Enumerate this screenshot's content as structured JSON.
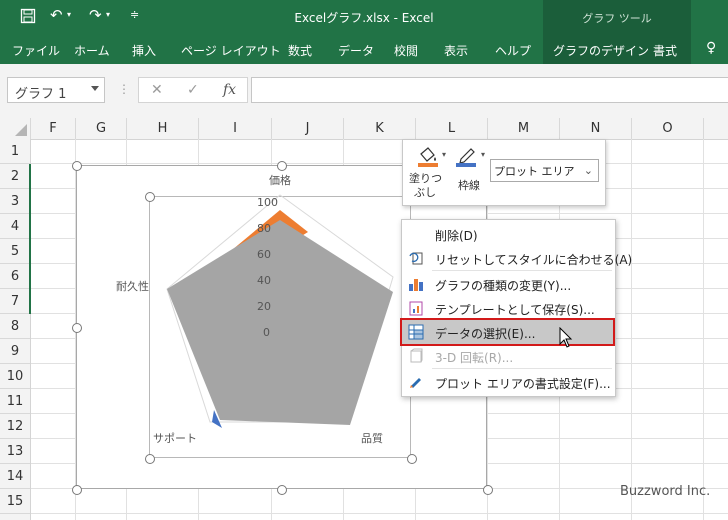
{
  "window": {
    "title": "Excelグラフ.xlsx  -  Excel",
    "chart_tools": "グラフ ツール"
  },
  "ribbon": {
    "tabs": [
      "ファイル",
      "ホーム",
      "挿入",
      "ページ レイアウト",
      "数式",
      "データ",
      "校閲",
      "表示",
      "ヘルプ",
      "グラフのデザイン",
      "書式"
    ]
  },
  "formula_bar": {
    "name_box": "グラフ 1",
    "formula": ""
  },
  "sheet": {
    "columns": [
      "F",
      "G",
      "H",
      "I",
      "J",
      "K",
      "L",
      "M",
      "N",
      "O"
    ],
    "rows": [
      "1",
      "2",
      "3",
      "4",
      "5",
      "6",
      "7",
      "8",
      "9",
      "10",
      "11",
      "12",
      "13",
      "14",
      "15"
    ]
  },
  "chart": {
    "axis_ticks": [
      "100",
      "80",
      "60",
      "40",
      "20",
      "0"
    ],
    "categories": [
      "価格",
      "品質",
      "サポート",
      "耐久性"
    ]
  },
  "mini_toolbar": {
    "fill_label_1": "塗りつ",
    "fill_label_2": "ぶし",
    "outline_label": "枠線",
    "element_select": "プロット エリア"
  },
  "context_menu": {
    "items": [
      {
        "label": "削除(D)",
        "enabled": true
      },
      {
        "label": "リセットしてスタイルに合わせる(A)",
        "enabled": true
      },
      {
        "label": "グラフの種類の変更(Y)...",
        "enabled": true
      },
      {
        "label": "テンプレートとして保存(S)...",
        "enabled": true
      },
      {
        "label": "データの選択(E)...",
        "enabled": true
      },
      {
        "label": "3-D 回転(R)...",
        "enabled": false
      },
      {
        "label": "プロット エリアの書式設定(F)...",
        "enabled": true
      }
    ]
  },
  "watermark": "Buzzword Inc.",
  "colors": {
    "excel_green": "#217346",
    "series_orange": "#ed7d31",
    "series_blue": "#4472c4",
    "series_gray": "#a5a5a5",
    "highlight_red": "#d21a1a"
  }
}
